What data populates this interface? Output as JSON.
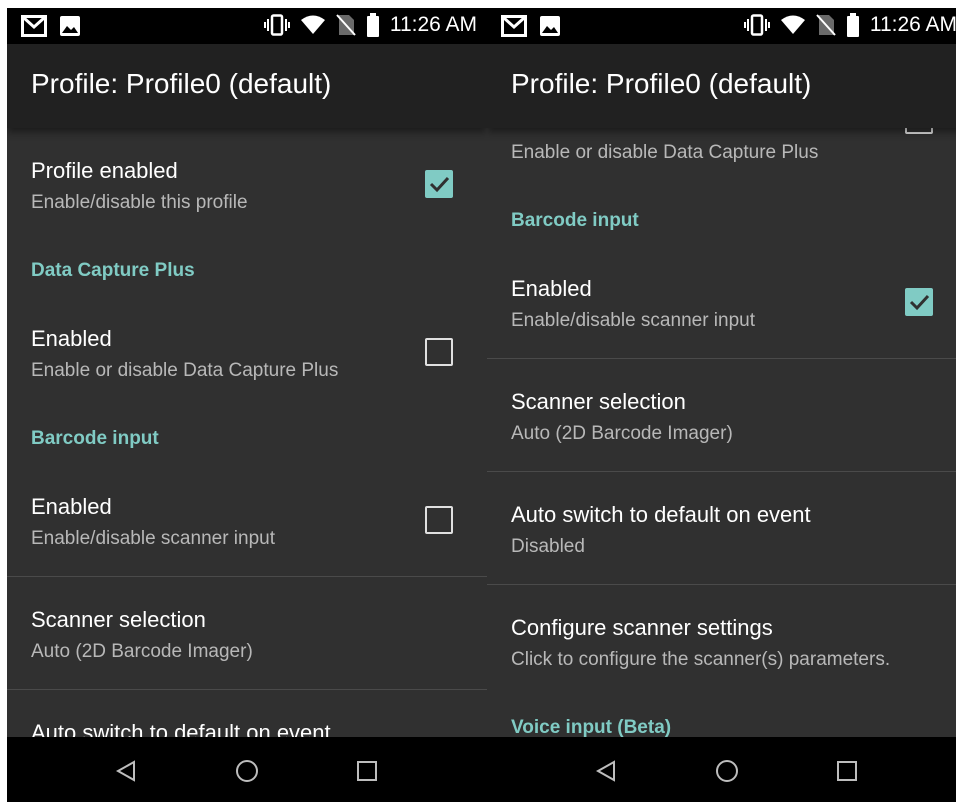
{
  "status_bar": {
    "time": "11:26 AM",
    "icons": [
      "gmail-icon",
      "image-icon",
      "vibrate-icon",
      "wifi-icon",
      "no-sim-icon",
      "battery-icon"
    ]
  },
  "toolbar": {
    "title": "Profile: Profile0 (default)"
  },
  "colors": {
    "accent": "#80cbc4",
    "background": "#303030",
    "toolbar": "#212121"
  },
  "left_panel": {
    "profile_enabled": {
      "title": "Profile enabled",
      "summary": "Enable/disable this profile",
      "checked": true
    },
    "data_capture_plus": {
      "category": "Data Capture Plus",
      "enabled": {
        "title": "Enabled",
        "summary": "Enable or disable Data Capture Plus",
        "checked": false
      }
    },
    "barcode_input": {
      "category": "Barcode input",
      "enabled": {
        "title": "Enabled",
        "summary": "Enable/disable scanner input",
        "checked": false
      },
      "scanner_selection": {
        "title": "Scanner selection",
        "summary": "Auto (2D Barcode Imager)"
      },
      "auto_switch": {
        "title": "Auto switch to default on event"
      }
    }
  },
  "right_panel": {
    "data_capture_plus_partial": {
      "summary": "Enable or disable Data Capture Plus",
      "checked": false
    },
    "barcode_input": {
      "category": "Barcode input",
      "enabled": {
        "title": "Enabled",
        "summary": "Enable/disable scanner input",
        "checked": true
      },
      "scanner_selection": {
        "title": "Scanner selection",
        "summary": "Auto (2D Barcode Imager)"
      },
      "auto_switch": {
        "title": "Auto switch to default on event",
        "summary": "Disabled"
      },
      "configure": {
        "title": "Configure scanner settings",
        "summary": "Click to configure the scanner(s) parameters."
      }
    },
    "voice_input": {
      "category": "Voice input (Beta)"
    }
  }
}
